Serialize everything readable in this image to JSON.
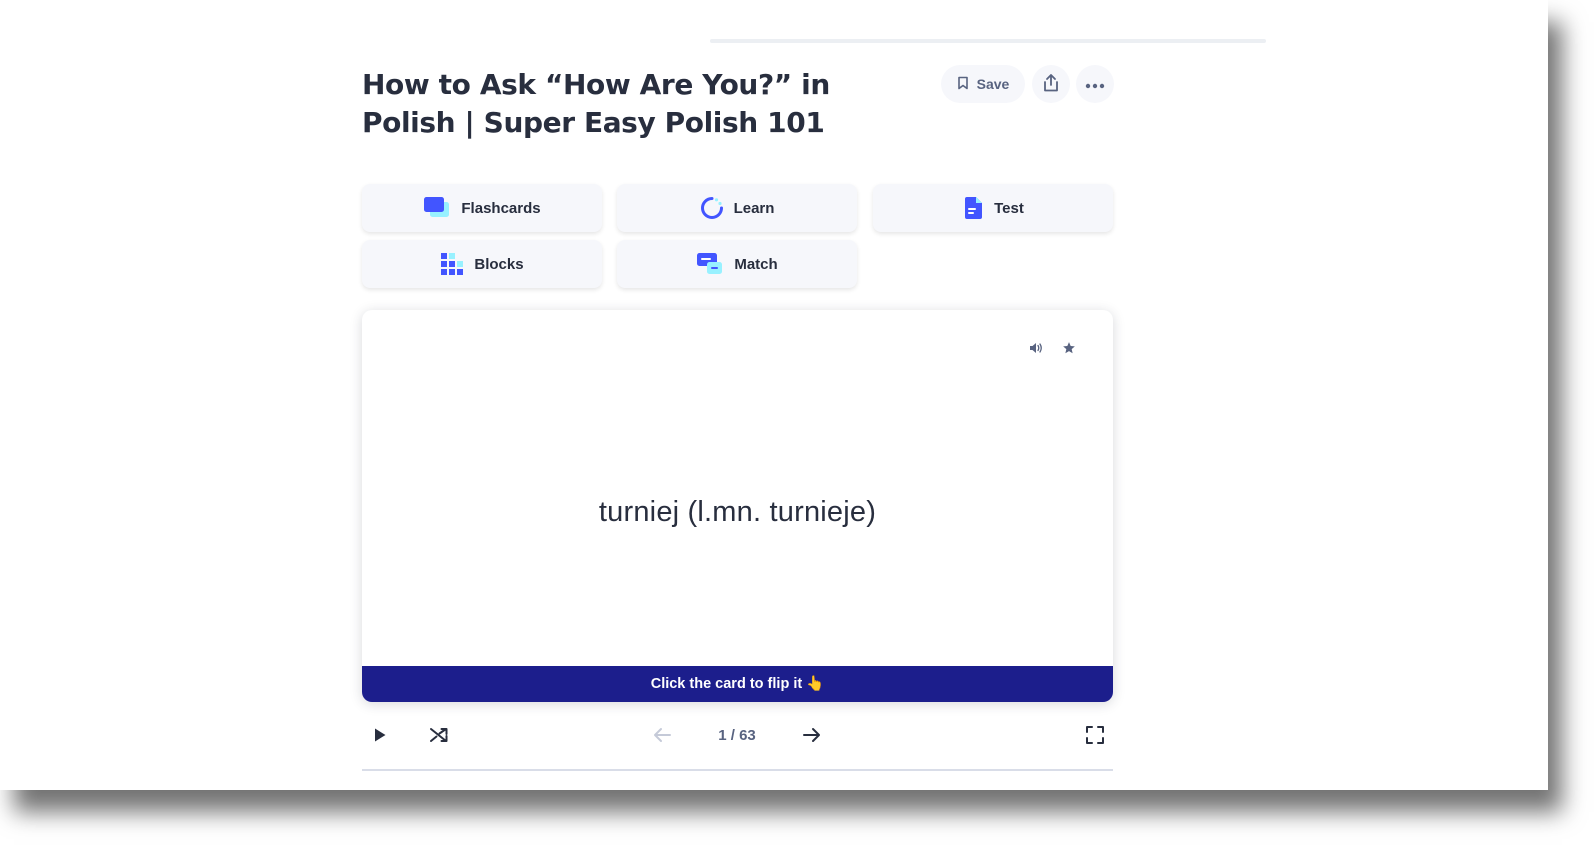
{
  "set": {
    "title": "How to Ask “How Are You?” in Polish | Super Easy Polish 101"
  },
  "header_actions": {
    "save_label": "Save",
    "save_icon": "bookmark-icon",
    "share_icon": "share-icon",
    "more_icon": "more-horizontal-icon"
  },
  "study_modes": [
    {
      "label": "Flashcards",
      "icon": "flashcards-icon"
    },
    {
      "label": "Learn",
      "icon": "learn-icon"
    },
    {
      "label": "Test",
      "icon": "test-icon"
    },
    {
      "label": "Blocks",
      "icon": "blocks-icon"
    },
    {
      "label": "Match",
      "icon": "match-icon"
    }
  ],
  "card": {
    "term": "turniej (l.mn. turnieje)",
    "flip_hint": "Click the card to flip it 👆",
    "audio_icon": "speaker-icon",
    "star_icon": "star-icon"
  },
  "controls": {
    "counter": "1 / 63",
    "current": 1,
    "total": 63,
    "play_icon": "play-icon",
    "shuffle_icon": "shuffle-icon",
    "prev_icon": "arrow-left-icon",
    "next_icon": "arrow-right-icon",
    "fullscreen_icon": "fullscreen-icon"
  },
  "colors": {
    "flip_bar": "#1c1e8c",
    "accent_blue": "#4255ff",
    "text_dark": "#282e3e",
    "text_muted": "#586380"
  }
}
